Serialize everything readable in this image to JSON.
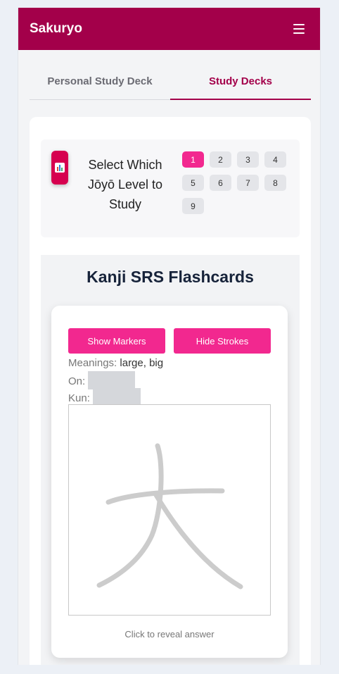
{
  "header": {
    "title": "Sakuryo",
    "menu_icon": "hamburger-menu-icon"
  },
  "tabs": [
    {
      "label": "Personal Study Deck",
      "active": false
    },
    {
      "label": "Study Decks",
      "active": true
    }
  ],
  "level_selector": {
    "icon": "bar-chart-icon",
    "title": "Select Which Jōyō Level to Study",
    "levels": [
      "1",
      "2",
      "3",
      "4",
      "5",
      "6",
      "7",
      "8",
      "9"
    ],
    "selected": "1"
  },
  "flashcards": {
    "title": "Kanji SRS Flashcards",
    "show_markers_label": "Show Markers",
    "hide_strokes_label": "Hide Strokes",
    "meanings_label": "Meanings:",
    "meanings_value": "large, big",
    "on_label": "On:",
    "kun_label": "Kun:",
    "reveal_hint": "Click to reveal answer"
  },
  "colors": {
    "brand": "#a3004a",
    "accent": "#f2288f"
  }
}
